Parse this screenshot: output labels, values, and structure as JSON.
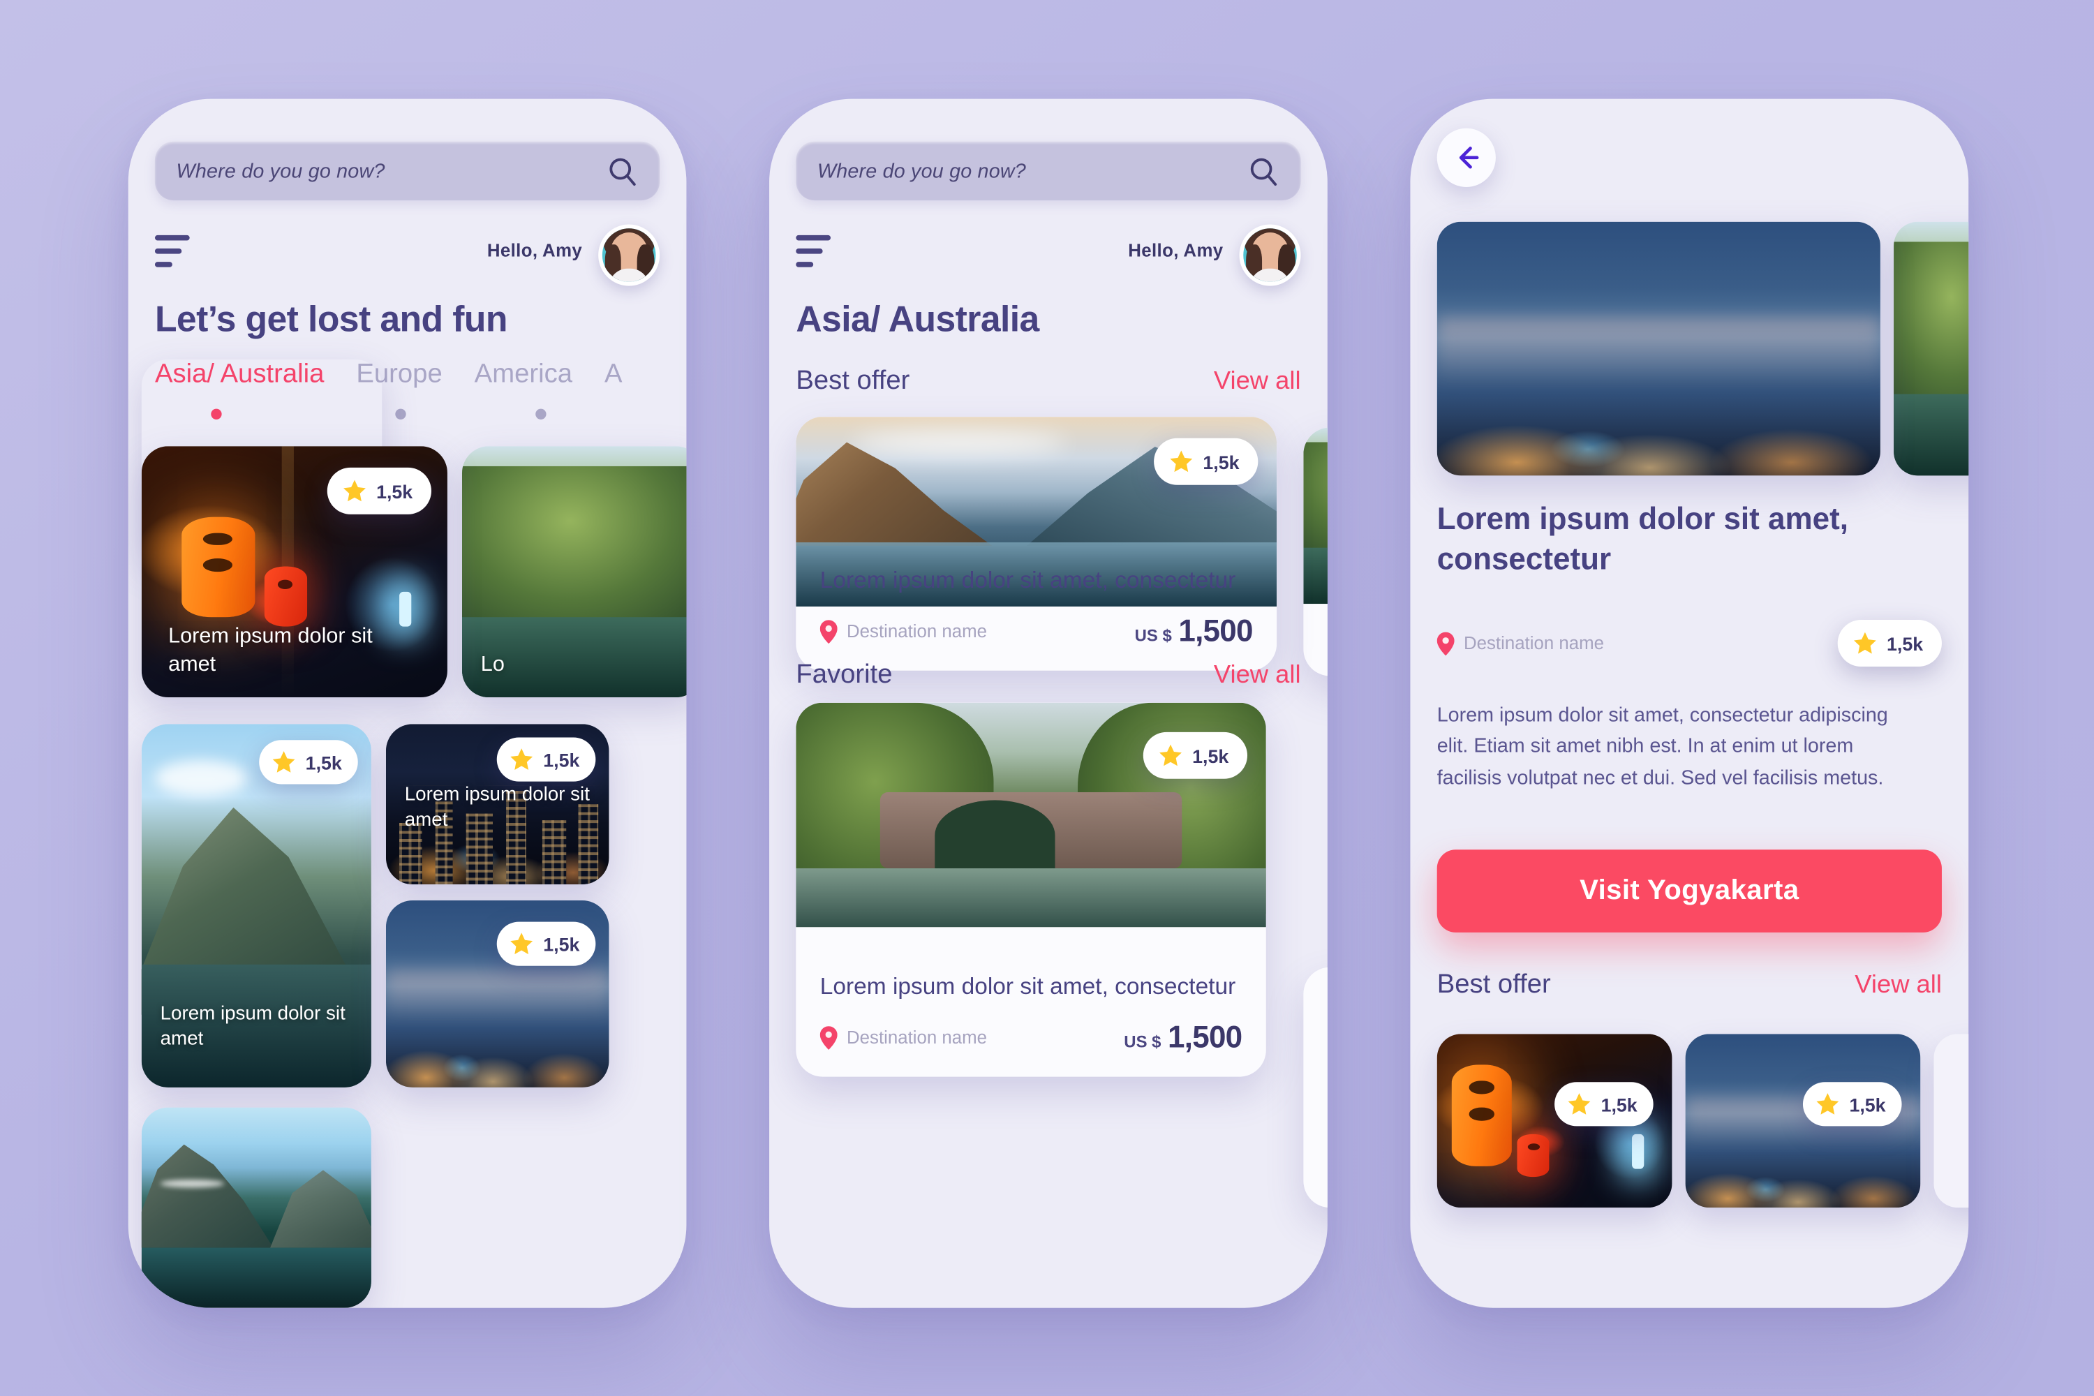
{
  "theme": {
    "bg": "#b8b5e4",
    "screen_bg": "#edecf7",
    "accent_pink": "#f4436a",
    "cta_red": "#fb4a63",
    "ink": "#474281",
    "muted": "#a6a3bf",
    "search_bg": "#c5c2de",
    "star_yellow": "#ffc727"
  },
  "search": {
    "placeholder": "Where do you go now?",
    "icon": "search-icon"
  },
  "user": {
    "greeting": "Hello, Amy",
    "avatar": "avatar"
  },
  "screen1": {
    "heading": "Let’s get lost and fun",
    "tabs": [
      {
        "label": "Asia/ Australia",
        "active": true
      },
      {
        "label": "Europe",
        "active": false
      },
      {
        "label": "America",
        "active": false
      },
      {
        "label": "A",
        "active": false
      }
    ],
    "cards": [
      {
        "caption": "Lorem ipsum dolor sit amet",
        "rating": "1,5k",
        "image": "japan-lantern-alley"
      },
      {
        "caption": "Lo",
        "rating": "",
        "image": "forest-river"
      },
      {
        "caption": "Lorem ipsum dolor sit amet",
        "rating": "1,5k",
        "image": "mountain-lake"
      },
      {
        "caption": "Lorem ipsum dolor sit amet",
        "rating": "1,5k",
        "image": "hongkong-night"
      },
      {
        "caption": "",
        "rating": "1,5k",
        "image": "hongkong-dusk"
      }
    ]
  },
  "screen2": {
    "heading": "Asia/ Australia",
    "sections": [
      {
        "label": "Best offer",
        "view_all": "View all"
      },
      {
        "label": "Favorite",
        "view_all": "View all"
      }
    ],
    "offers": [
      {
        "title": "Lorem ipsum dolor sit amet, consectetur",
        "destination": "Destination name",
        "currency": "US $",
        "price": "1,500",
        "rating": "1,5k",
        "image": "norway-lake-sunrise"
      },
      {
        "title": "Lorem ipsum dolor sit amet, consectetur",
        "destination": "Destination name",
        "currency": "US $",
        "price": "1,500",
        "rating": "1,5k",
        "image": "stone-bridge-river"
      }
    ]
  },
  "screen3": {
    "back_icon": "back-arrow-icon",
    "hero_image": "hongkong-skyline-dusk",
    "hero_side_image": "forest-river",
    "title": "Lorem ipsum dolor sit amet, consectetur",
    "destination": "Destination name",
    "rating": "1,5k",
    "description": "Lorem ipsum dolor sit amet, consectetur adipiscing elit. Etiam sit amet nibh est. In at enim ut lorem facilisis volutpat nec et dui. Sed vel facilisis metus.",
    "cta_label": "Visit Yogyakarta",
    "section": {
      "label": "Best offer",
      "view_all": "View all"
    },
    "tiles": [
      {
        "rating": "1,5k",
        "image": "japan-lantern-alley"
      },
      {
        "rating": "1,5k",
        "image": "hongkong-dusk"
      },
      {
        "rating": "",
        "image": "partial-card"
      }
    ]
  }
}
